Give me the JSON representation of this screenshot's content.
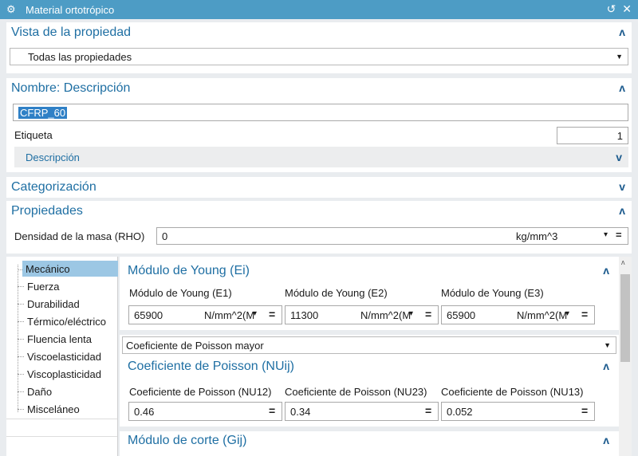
{
  "window": {
    "title": "Material ortotrópico",
    "gear_icon": "⚙",
    "controls": "↺ ✕"
  },
  "vista": {
    "heading": "Vista de la propiedad",
    "selected": "Todas las propiedades"
  },
  "nombre": {
    "heading": "Nombre: Descripción",
    "name_value": "CFRP_60",
    "etiqueta_label": "Etiqueta",
    "etiqueta_value": "1",
    "descripcion_label": "Descripción"
  },
  "categorizacion": {
    "heading": "Categorización"
  },
  "propiedades": {
    "heading": "Propiedades",
    "rho_label": "Densidad de la masa (RHO)",
    "rho_value": "0",
    "rho_unit": "kg/mm^3"
  },
  "tree": {
    "items": [
      "Mecánico",
      "Fuerza",
      "Durabilidad",
      "Térmico/eléctrico",
      "Fluencia lenta",
      "Viscoelasticidad",
      "Viscoplasticidad",
      "Daño",
      "Misceláneo"
    ]
  },
  "young": {
    "heading": "Módulo de Young (Ei)",
    "fields": [
      {
        "label": "Módulo de Young (E1)",
        "value": "65900",
        "unit": "N/mm^2(M"
      },
      {
        "label": "Módulo de Young (E2)",
        "value": "11300",
        "unit": "N/mm^2(M"
      },
      {
        "label": "Módulo de Young (E3)",
        "value": "65900",
        "unit": "N/mm^2(M"
      }
    ]
  },
  "poisson_select": "Coeficiente de Poisson mayor",
  "poisson": {
    "heading": "Coeficiente de Poisson (NUij)",
    "fields": [
      {
        "label": "Coeficiente de Poisson (NU12)",
        "value": "0.46"
      },
      {
        "label": "Coeficiente de Poisson (NU23)",
        "value": "0.34"
      },
      {
        "label": "Coeficiente de Poisson (NU13)",
        "value": "0.052"
      }
    ]
  },
  "corte": {
    "heading": "Módulo de corte (Gij)"
  },
  "symbols": {
    "equals": "=",
    "chev_up": "ʌ",
    "chev_down": "v",
    "dropdown": "▼",
    "small_dropdown": "▾"
  }
}
